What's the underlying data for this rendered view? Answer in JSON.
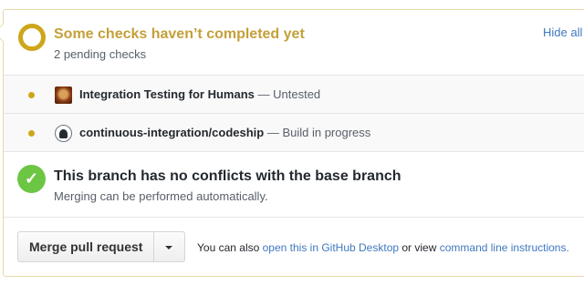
{
  "status": {
    "title": "Some checks haven’t completed yet",
    "subtitle": "2 pending checks",
    "hide_all_label": "Hide all",
    "color": "#cea61b"
  },
  "checks": [
    {
      "name": "Integration Testing for Humans",
      "separator": " — ",
      "state": "Untested",
      "avatar": "integration-testing-avatar"
    },
    {
      "name": "continuous-integration/codeship",
      "separator": " — ",
      "state": "Build in progress",
      "avatar": "codeship-avatar"
    }
  ],
  "merge_status": {
    "icon": "check-icon",
    "title": "This branch has no conflicts with the base branch",
    "subtitle": "Merging can be performed automatically.",
    "color": "#6cc644"
  },
  "merge_actions": {
    "merge_button_label": "Merge pull request",
    "dropdown_icon": "caret-down-icon",
    "help_prefix": "You can also ",
    "desktop_link": "open this in GitHub Desktop",
    "help_middle": " or view ",
    "cli_link": "command line instructions."
  }
}
